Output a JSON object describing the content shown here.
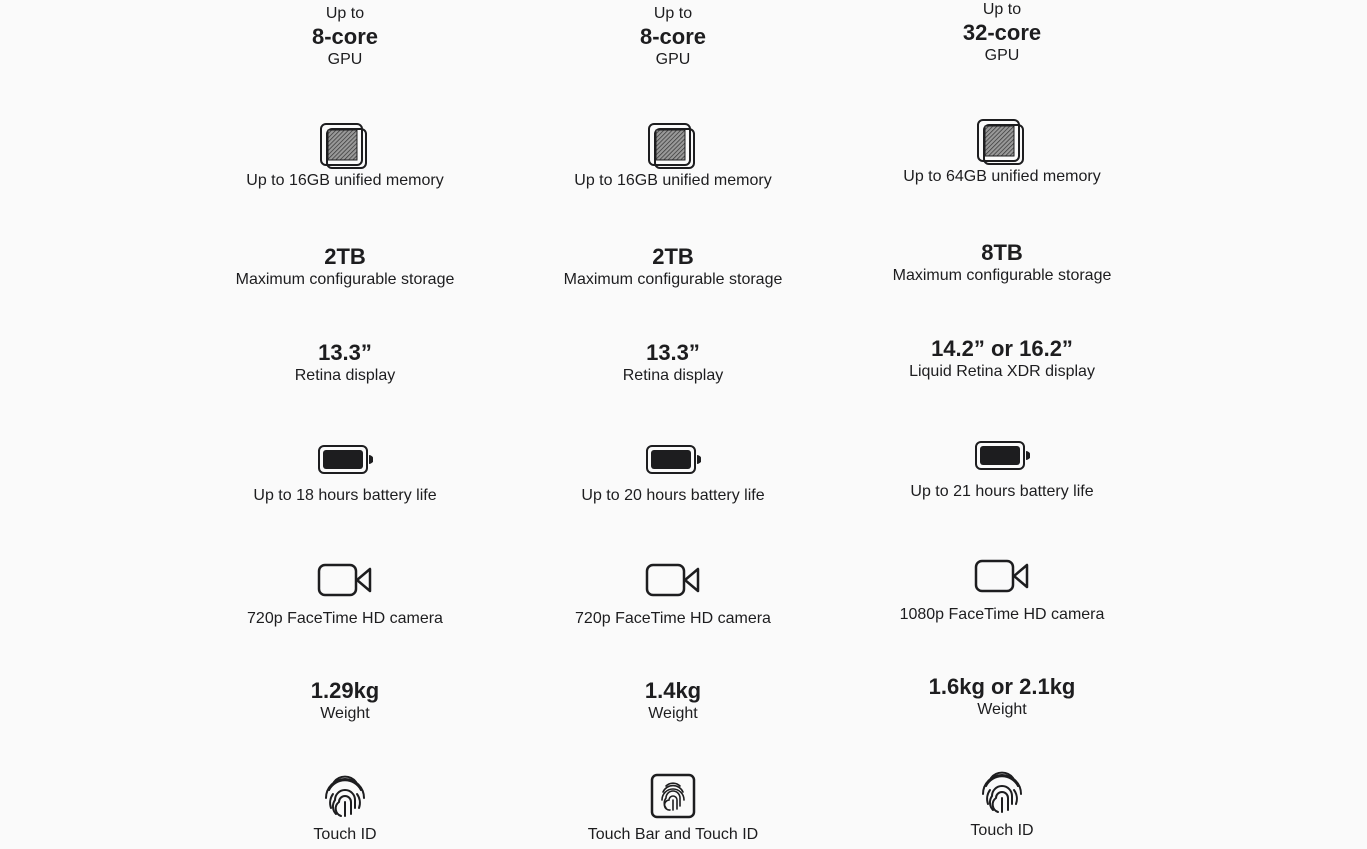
{
  "columns": [
    {
      "gpu": {
        "pre": "Up to",
        "value": "8-core",
        "label": "GPU"
      },
      "memory": "Up to 16GB unified memory",
      "storage": {
        "value": "2TB",
        "label": "Maximum configurable storage"
      },
      "display": {
        "value": "13.3”",
        "label": "Retina display"
      },
      "battery": "Up to 18 hours battery life",
      "camera": "720p FaceTime HD camera",
      "weight": {
        "value": "1.29kg",
        "label": "Weight"
      },
      "security": {
        "label": "Touch ID",
        "icon": "fingerprint-icon"
      }
    },
    {
      "gpu": {
        "pre": "Up to",
        "value": "8-core",
        "label": "GPU"
      },
      "memory": "Up to 16GB unified memory",
      "storage": {
        "value": "2TB",
        "label": "Maximum configurable storage"
      },
      "display": {
        "value": "13.3”",
        "label": "Retina display"
      },
      "battery": "Up to 20 hours battery life",
      "camera": "720p FaceTime HD camera",
      "weight": {
        "value": "1.4kg",
        "label": "Weight"
      },
      "security": {
        "label": "Touch Bar and Touch ID",
        "icon": "touch-bar-fingerprint-icon"
      }
    },
    {
      "gpu": {
        "pre": "Up to",
        "value": "32-core",
        "label": "GPU"
      },
      "memory": "Up to 64GB unified memory",
      "storage": {
        "value": "8TB",
        "label": "Maximum configurable storage"
      },
      "display": {
        "value": "14.2” or 16.2”",
        "label": "Liquid Retina XDR display"
      },
      "battery": "Up to 21 hours battery life",
      "camera": "1080p FaceTime HD camera",
      "weight": {
        "value": "1.6kg or 2.1kg",
        "label": "Weight"
      },
      "security": {
        "label": "Touch ID",
        "icon": "fingerprint-icon"
      }
    }
  ]
}
